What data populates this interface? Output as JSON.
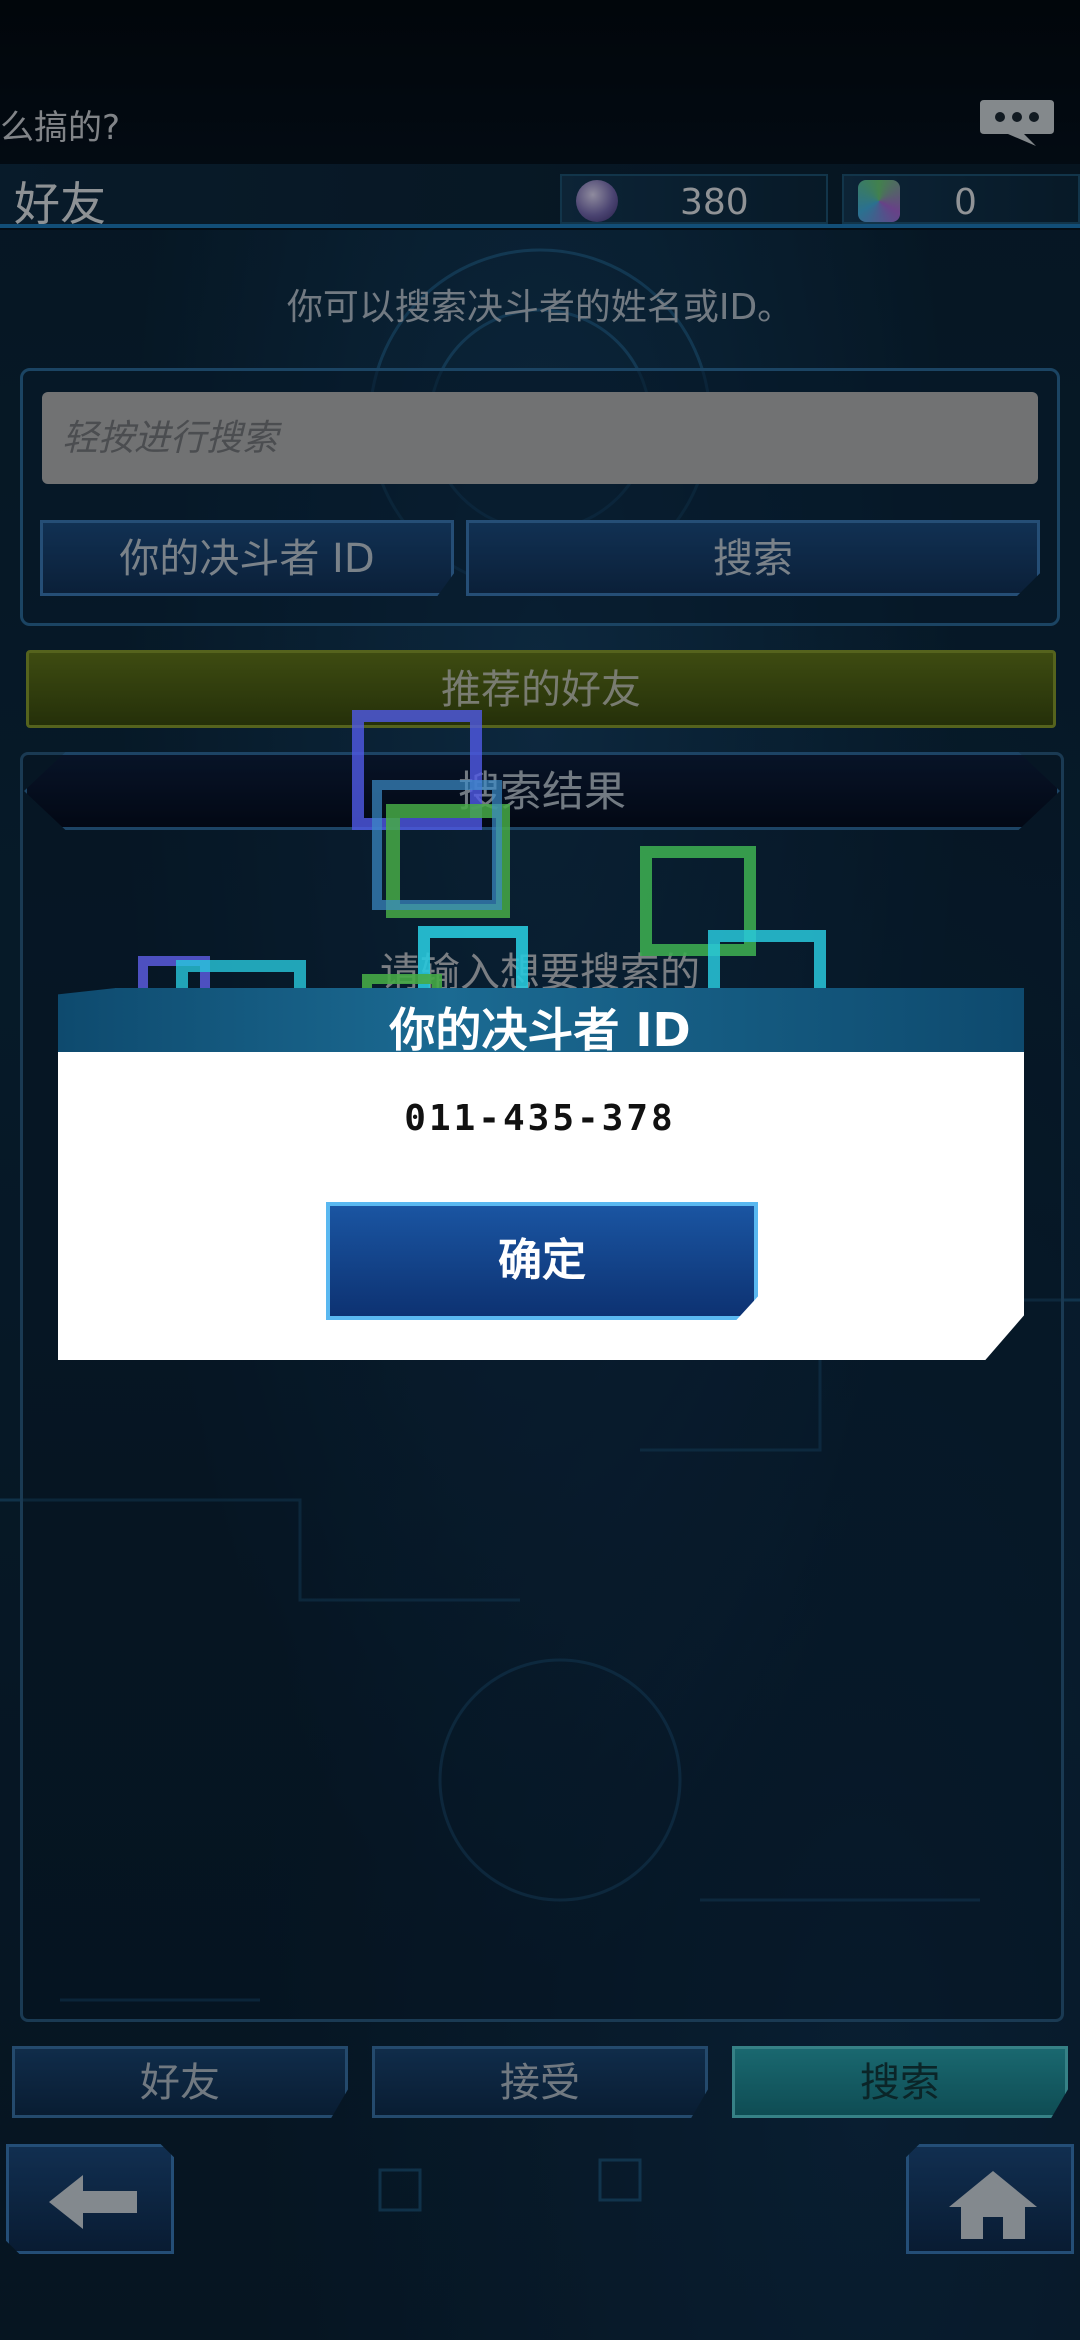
{
  "top": {
    "marquee": "么搞的?",
    "title": "好友",
    "currencies": [
      {
        "icon": "gem-orb-icon",
        "value": "380"
      },
      {
        "icon": "crystal-icon",
        "value": "0"
      }
    ]
  },
  "search": {
    "hint": "你可以搜索决斗者的姓名或ID。",
    "placeholder": "轻按进行搜索",
    "your_id_button": "你的决斗者 ID",
    "search_button": "搜索"
  },
  "recommended": {
    "label": "推荐的好友"
  },
  "results": {
    "header": "搜索结果",
    "placeholder": "请输入想要搜索的"
  },
  "dialog": {
    "title": "你的决斗者 ID",
    "duelist_id": "011-435-378",
    "ok_button": "确定"
  },
  "tabs": [
    {
      "label": "好友"
    },
    {
      "label": "接受"
    },
    {
      "label": "搜索"
    }
  ],
  "colors": {
    "accent_blue": "#1e7fc0",
    "tab_active": "#2aa8b4",
    "recommend_green": "#647a1c"
  }
}
